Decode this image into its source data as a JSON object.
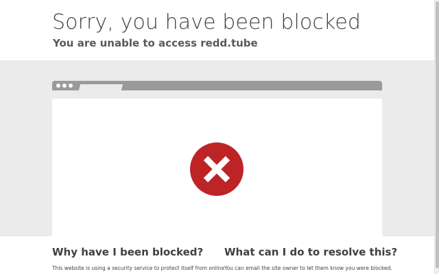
{
  "header": {
    "title": "Sorry, you have been blocked",
    "subtitle": "You are unable to access redd.tube"
  },
  "browser_illustration": {
    "icon": "error-x-icon",
    "icon_color": "#bd2426"
  },
  "sections": {
    "why_heading": "Why have I been blocked?",
    "why_text": "This website is using a security service to protect itself from online",
    "resolve_heading": "What can I do to resolve this?",
    "resolve_text": "You can email the site owner to let them know you were blocked."
  },
  "colors": {
    "gray_band": "#ebebeb",
    "browser_bar": "#9a9a9a",
    "text": "#404040"
  }
}
